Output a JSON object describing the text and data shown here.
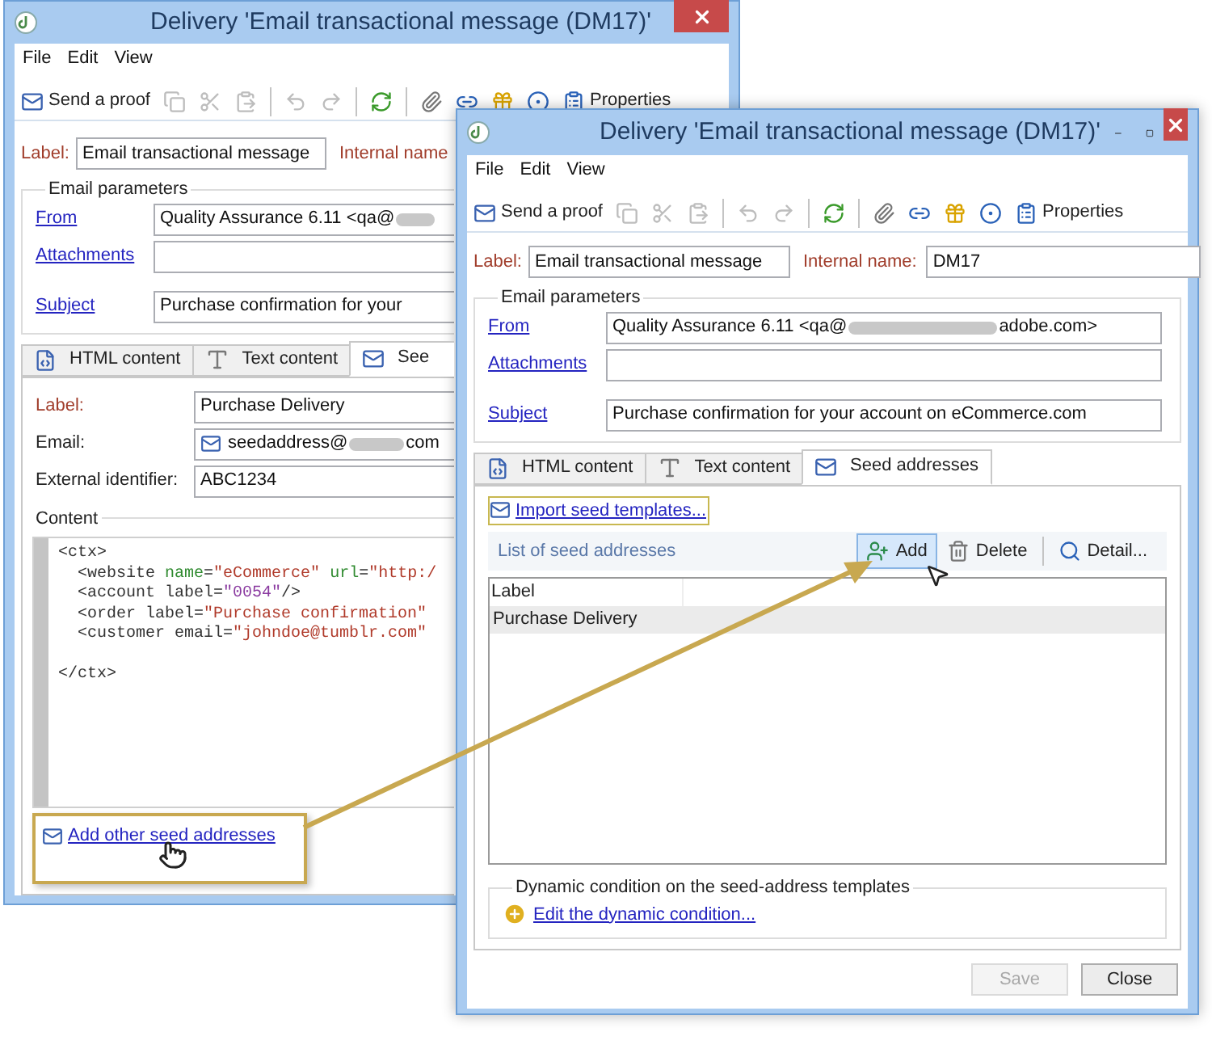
{
  "back_window": {
    "title": "Delivery 'Email transactional message (DM17)'",
    "menu": [
      "File",
      "Edit",
      "View"
    ],
    "toolbar": [
      {
        "kind": "send",
        "label": "Send a proof"
      },
      {
        "kind": "copy",
        "disabled": true
      },
      {
        "kind": "cut",
        "disabled": true
      },
      {
        "kind": "paste",
        "disabled": true
      },
      {
        "kind": "separator"
      },
      {
        "kind": "undo",
        "disabled": true
      },
      {
        "kind": "redo",
        "disabled": true
      },
      {
        "kind": "separator"
      },
      {
        "kind": "refresh",
        "disabled": false
      },
      {
        "kind": "separator"
      },
      {
        "kind": "attach",
        "disabled": false
      },
      {
        "kind": "link",
        "disabled": false
      },
      {
        "kind": "gift",
        "disabled": false
      },
      {
        "kind": "target",
        "disabled": false
      },
      {
        "kind": "properties",
        "label": "Properties"
      }
    ],
    "label": {
      "caption": "Label:",
      "value": "Email transactional message"
    },
    "internal_name": {
      "caption": "Internal name"
    },
    "email_parameters": {
      "title": "Email parameters",
      "from": {
        "link": "From",
        "value_start": "Quality Assurance 6.11 <qa@"
      },
      "attachments": {
        "link": "Attachments"
      },
      "subject": {
        "link": "Subject",
        "value": "Purchase confirmation for your"
      }
    },
    "tabs": [
      {
        "kind": "html",
        "label": "HTML content",
        "selected": false
      },
      {
        "kind": "text",
        "label": "Text content",
        "selected": false
      },
      {
        "kind": "seed",
        "label": "See",
        "selected": true
      }
    ],
    "seed": {
      "label": {
        "caption": "Label:",
        "value": "Purchase Delivery"
      },
      "email": {
        "caption": "Email:",
        "value_start": "seedaddress@",
        "value_end": "com"
      },
      "external_id": {
        "caption": "External identifier:",
        "value": "ABC1234"
      },
      "content_title": "Content",
      "code": [
        {
          "kind": "code",
          "tokens": [
            {
              "kind": "tag",
              "text": "<ctx>"
            }
          ]
        },
        {
          "kind": "code",
          "tokens": [
            {
              "kind": "tag",
              "text": "  <website "
            },
            {
              "kind": "attr",
              "text": "name"
            },
            {
              "kind": "tag",
              "text": "="
            },
            {
              "kind": "value",
              "text": "\"eCommerce\""
            },
            {
              "kind": "attr",
              "text": " url"
            },
            {
              "kind": "tag",
              "text": "="
            },
            {
              "kind": "value",
              "text": "\"http:/"
            }
          ]
        },
        {
          "kind": "code",
          "tokens": [
            {
              "kind": "tag",
              "text": "  <account label="
            },
            {
              "kind": "number",
              "text": "\"0054\""
            },
            {
              "kind": "tag",
              "text": "/>"
            }
          ]
        },
        {
          "kind": "code",
          "tokens": [
            {
              "kind": "tag",
              "text": "  <order label="
            },
            {
              "kind": "value",
              "text": "\"Purchase confirmation\""
            }
          ]
        },
        {
          "kind": "code",
          "tokens": [
            {
              "kind": "tag",
              "text": "  <customer email="
            },
            {
              "kind": "value",
              "text": "\"johndoe@tumblr.com\""
            }
          ]
        },
        {
          "kind": "blank"
        },
        {
          "kind": "code",
          "tokens": [
            {
              "kind": "tag",
              "text": "</ctx>"
            }
          ]
        }
      ],
      "add_link": "Add other seed addresses"
    }
  },
  "front_window": {
    "title": "Delivery 'Email transactional message (DM17)'",
    "menu": [
      "File",
      "Edit",
      "View"
    ],
    "toolbar": [
      {
        "kind": "send",
        "label": "Send a proof"
      },
      {
        "kind": "copy",
        "disabled": true
      },
      {
        "kind": "cut",
        "disabled": true
      },
      {
        "kind": "paste",
        "disabled": true
      },
      {
        "kind": "separator"
      },
      {
        "kind": "undo",
        "disabled": true
      },
      {
        "kind": "redo",
        "disabled": true
      },
      {
        "kind": "separator"
      },
      {
        "kind": "refresh",
        "disabled": false
      },
      {
        "kind": "separator"
      },
      {
        "kind": "attach",
        "disabled": false
      },
      {
        "kind": "link",
        "disabled": false
      },
      {
        "kind": "gift",
        "disabled": false
      },
      {
        "kind": "target",
        "disabled": false
      },
      {
        "kind": "properties",
        "label": "Properties"
      }
    ],
    "label": {
      "caption": "Label:",
      "value": "Email transactional message"
    },
    "internal_name": {
      "caption": "Internal name:",
      "value": "DM17"
    },
    "email_parameters": {
      "title": "Email parameters",
      "from": {
        "link": "From",
        "value_start": "Quality Assurance 6.11 <qa@",
        "value_end": "adobe.com>"
      },
      "attachments": {
        "link": "Attachments"
      },
      "subject": {
        "link": "Subject",
        "value": "Purchase confirmation for your account on eCommerce.com"
      }
    },
    "tabs": [
      {
        "kind": "html",
        "label": "HTML content",
        "selected": false
      },
      {
        "kind": "text",
        "label": "Text content",
        "selected": false
      },
      {
        "kind": "seed",
        "label": "Seed addresses",
        "selected": true
      }
    ],
    "import_link": "Import seed templates...",
    "list_title": "List of seed addresses",
    "list_buttons": [
      {
        "kind": "add",
        "label": "Add",
        "highlighted": true
      },
      {
        "kind": "delete",
        "label": "Delete",
        "highlighted": false
      },
      {
        "kind": "separator"
      },
      {
        "kind": "detail",
        "label": "Detail...",
        "highlighted": false
      }
    ],
    "columns": [
      "Label"
    ],
    "rows": [
      {
        "label": "Purchase Delivery",
        "selected": true
      }
    ],
    "dynamic": {
      "title": "Dynamic condition on the seed-address templates",
      "link": "Edit the dynamic condition..."
    },
    "buttons": [
      {
        "label": "Save",
        "disabled": true
      },
      {
        "label": "Close",
        "disabled": false
      }
    ]
  }
}
